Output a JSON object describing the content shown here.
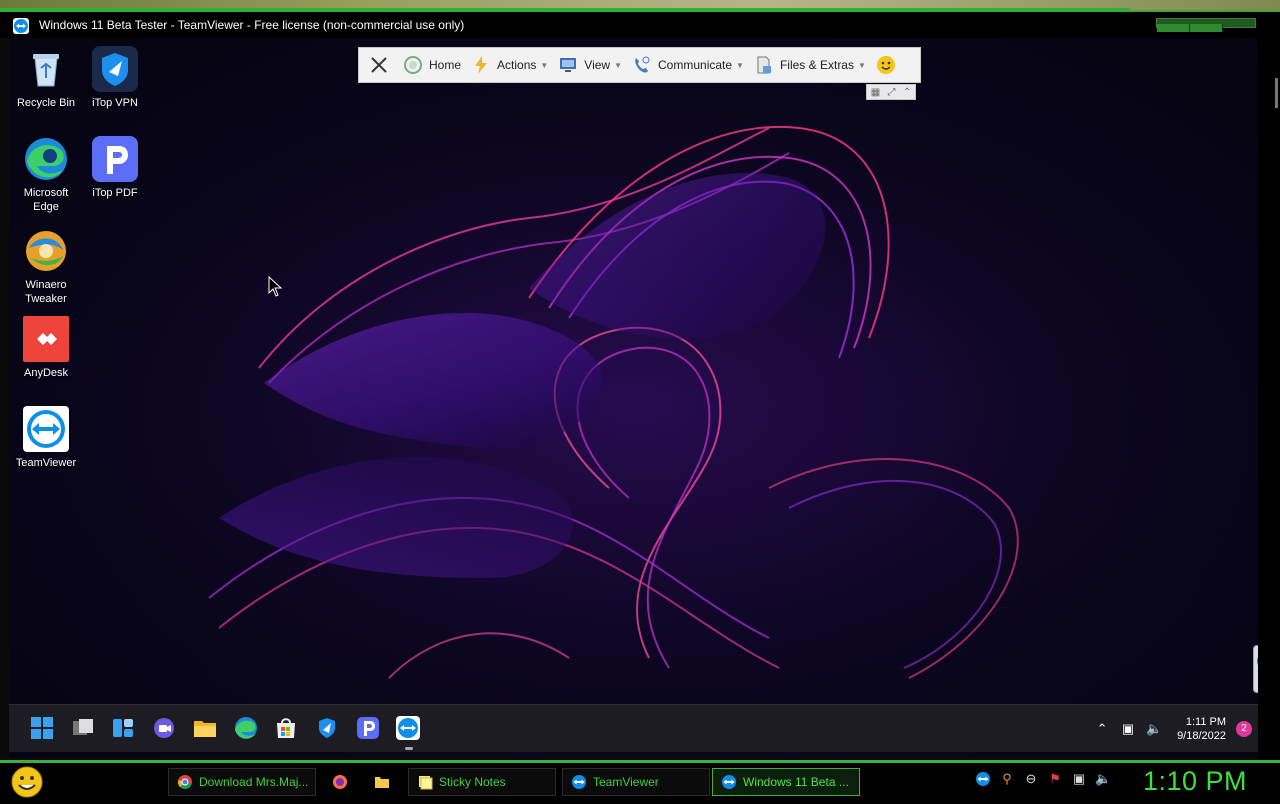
{
  "host": {
    "window_title": "Windows 11 Beta Tester - TeamViewer - Free license (non-commercial use only)",
    "taskbar": {
      "items": [
        {
          "label": "Download Mrs.Maj...",
          "icon": "chrome-icon"
        },
        {
          "label": "",
          "icon": "firefox-icon"
        },
        {
          "label": "",
          "icon": "folder-icon"
        },
        {
          "label": "Sticky Notes",
          "icon": "sticky-notes-icon"
        },
        {
          "label": "TeamViewer",
          "icon": "teamviewer-icon"
        },
        {
          "label": "Windows 11 Beta ...",
          "icon": "teamviewer-icon"
        }
      ],
      "clock": "1:10 PM"
    }
  },
  "toolbar": {
    "home": "Home",
    "actions": "Actions",
    "view": "View",
    "communicate": "Communicate",
    "files_extras": "Files & Extras"
  },
  "desktop": {
    "icons": [
      {
        "label": "Recycle Bin",
        "icon": "recycle-bin-icon"
      },
      {
        "label": "iTop VPN",
        "icon": "itop-vpn-icon"
      },
      {
        "label": "Microsoft Edge",
        "icon": "edge-icon"
      },
      {
        "label": "iTop PDF",
        "icon": "itop-pdf-icon"
      },
      {
        "label": "Winaero Tweaker",
        "icon": "winaero-tweaker-icon"
      },
      {
        "label": "AnyDesk",
        "icon": "anydesk-icon"
      },
      {
        "label": "TeamViewer",
        "icon": "teamviewer-icon"
      }
    ]
  },
  "remote_taskbar": {
    "pinned": [
      "start-icon",
      "task-view-icon",
      "widgets-icon",
      "chat-icon",
      "file-explorer-icon",
      "edge-icon",
      "store-icon",
      "itop-vpn-icon",
      "itop-pdf-icon",
      "teamviewer-icon"
    ],
    "time": "1:11 PM",
    "date": "9/18/2022",
    "notification_count": "2"
  },
  "colors": {
    "host_accent": "#3fae3f",
    "host_clock": "#3ee03e",
    "wallpaper_pink": "#e0389b",
    "wallpaper_purple": "#6a2bd6"
  }
}
